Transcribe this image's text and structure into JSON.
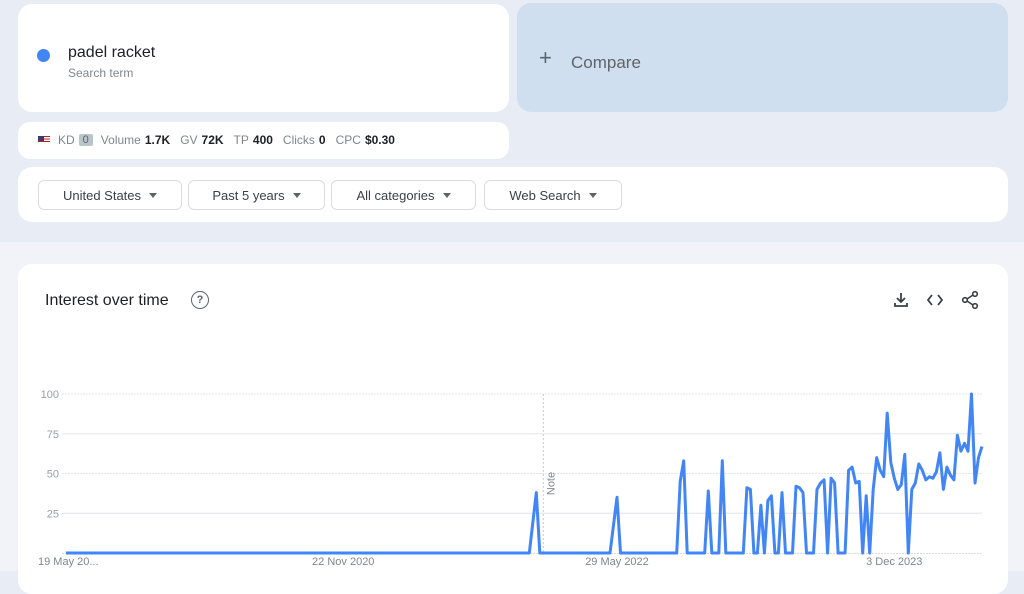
{
  "term": {
    "name": "padel racket",
    "subtitle": "Search term",
    "color": "#4285f4"
  },
  "compare": {
    "plus": "+",
    "label": "Compare"
  },
  "metrics": {
    "country_flag": "us-flag-icon",
    "kd_label": "KD",
    "kd_value": "0",
    "volume_label": "Volume",
    "volume_value": "1.7K",
    "gv_label": "GV",
    "gv_value": "72K",
    "tp_label": "TP",
    "tp_value": "400",
    "clicks_label": "Clicks",
    "clicks_value": "0",
    "cpc_label": "CPC",
    "cpc_value": "$0.30"
  },
  "filters": [
    {
      "label": "United States"
    },
    {
      "label": "Past 5 years"
    },
    {
      "label": "All categories"
    },
    {
      "label": "Web Search"
    }
  ],
  "chart_panel": {
    "title": "Interest over time",
    "help_icon": "?",
    "actions": [
      "download-icon",
      "embed-code-icon",
      "share-icon"
    ]
  },
  "chart_data": {
    "type": "line",
    "title": "Interest over time",
    "xlabel": "",
    "ylabel": "",
    "ylim": [
      0,
      100
    ],
    "yticks": [
      25,
      50,
      75,
      100
    ],
    "grid": true,
    "series_color": "#4285f4",
    "xtick_labels": [
      {
        "label": "19 May 20...",
        "week": 0
      },
      {
        "label": "22 Nov 2020",
        "week": 79
      },
      {
        "label": "29 May 2022",
        "week": 157
      },
      {
        "label": "3 Dec 2023",
        "week": 236
      }
    ],
    "annotation": {
      "label": "Note",
      "week": 136
    },
    "series": [
      {
        "name": "padel racket",
        "weeks_total": 262,
        "points": [
          [
            0,
            0
          ],
          [
            132,
            0
          ],
          [
            134,
            38
          ],
          [
            135,
            0
          ],
          [
            155,
            0
          ],
          [
            157,
            35
          ],
          [
            158,
            0
          ],
          [
            174,
            0
          ],
          [
            175,
            45
          ],
          [
            176,
            58
          ],
          [
            177,
            0
          ],
          [
            182,
            0
          ],
          [
            183,
            39
          ],
          [
            184,
            0
          ],
          [
            186,
            0
          ],
          [
            187,
            58
          ],
          [
            188,
            0
          ],
          [
            193,
            0
          ],
          [
            194,
            41
          ],
          [
            195,
            40
          ],
          [
            196,
            0
          ],
          [
            197,
            0
          ],
          [
            198,
            30
          ],
          [
            199,
            0
          ],
          [
            200,
            33
          ],
          [
            201,
            36
          ],
          [
            202,
            0
          ],
          [
            203,
            0
          ],
          [
            204,
            38
          ],
          [
            205,
            0
          ],
          [
            207,
            0
          ],
          [
            208,
            42
          ],
          [
            209,
            41
          ],
          [
            210,
            38
          ],
          [
            211,
            0
          ],
          [
            213,
            0
          ],
          [
            214,
            40
          ],
          [
            215,
            44
          ],
          [
            216,
            46
          ],
          [
            217,
            0
          ],
          [
            218,
            47
          ],
          [
            219,
            44
          ],
          [
            220,
            0
          ],
          [
            222,
            0
          ],
          [
            223,
            52
          ],
          [
            224,
            54
          ],
          [
            225,
            44
          ],
          [
            226,
            45
          ],
          [
            227,
            0
          ],
          [
            228,
            36
          ],
          [
            229,
            0
          ],
          [
            230,
            40
          ],
          [
            231,
            60
          ],
          [
            232,
            52
          ],
          [
            233,
            48
          ],
          [
            234,
            88
          ],
          [
            235,
            57
          ],
          [
            236,
            47
          ],
          [
            237,
            40
          ],
          [
            238,
            43
          ],
          [
            239,
            62
          ],
          [
            240,
            0
          ],
          [
            241,
            40
          ],
          [
            242,
            44
          ],
          [
            243,
            56
          ],
          [
            244,
            52
          ],
          [
            245,
            46
          ],
          [
            246,
            48
          ],
          [
            247,
            47
          ],
          [
            248,
            51
          ],
          [
            249,
            63
          ],
          [
            250,
            40
          ],
          [
            251,
            54
          ],
          [
            252,
            49
          ],
          [
            253,
            46
          ],
          [
            254,
            74
          ],
          [
            255,
            64
          ],
          [
            256,
            69
          ],
          [
            257,
            64
          ],
          [
            258,
            100
          ],
          [
            259,
            44
          ],
          [
            260,
            60
          ],
          [
            261,
            67
          ]
        ]
      }
    ]
  }
}
